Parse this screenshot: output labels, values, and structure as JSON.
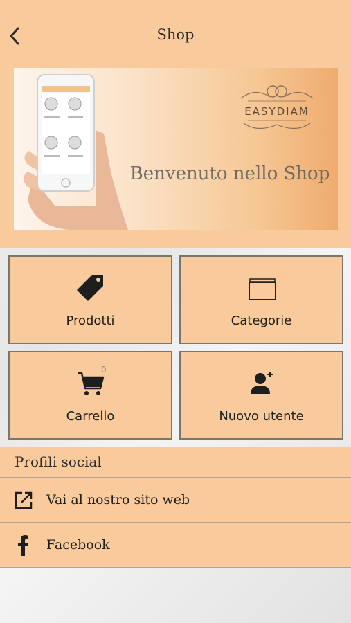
{
  "navbar": {
    "title": "Shop",
    "back_icon": "chevron-left-icon"
  },
  "banner": {
    "welcome_text": "Benvenuto nello Shop",
    "brand_name": "EASYDIAM"
  },
  "tiles": [
    {
      "label": "Prodotti",
      "icon": "tag-icon"
    },
    {
      "label": "Categorie",
      "icon": "folder-stack-icon"
    },
    {
      "label": "Carrello",
      "icon": "cart-icon",
      "badge": "0"
    },
    {
      "label": "Nuovo utente",
      "icon": "add-user-icon"
    }
  ],
  "social": {
    "header": "Profili social",
    "items": [
      {
        "label": "Vai al nostro sito web",
        "icon": "external-link-icon"
      },
      {
        "label": "Facebook",
        "icon": "facebook-icon"
      }
    ]
  },
  "colors": {
    "accent": "#f9cb9c",
    "border": "#7b756f"
  }
}
